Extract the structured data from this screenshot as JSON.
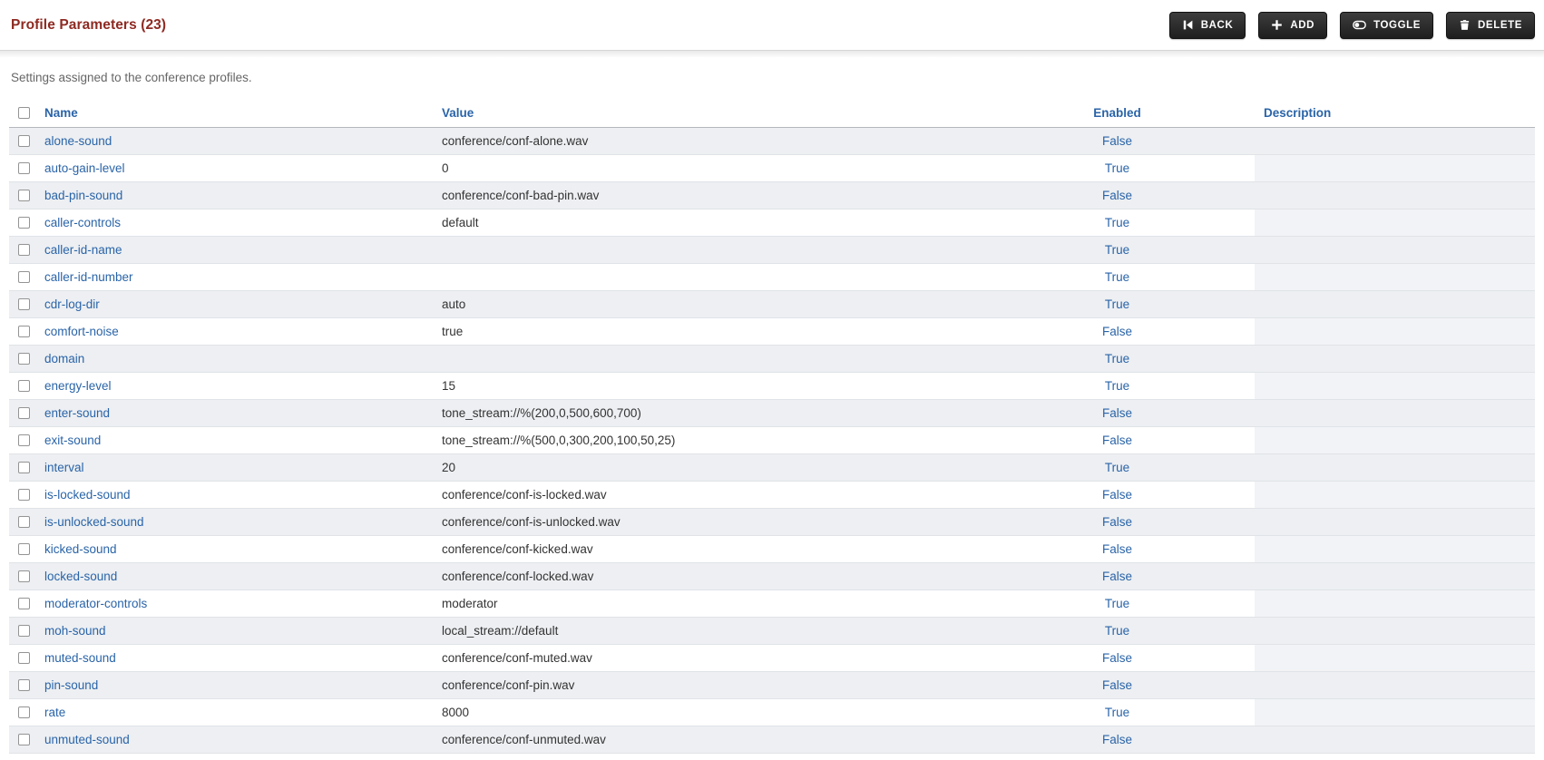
{
  "page": {
    "title": "Profile Parameters (23)",
    "subtitle": "Settings assigned to the conference profiles."
  },
  "toolbar": {
    "back_label": "BACK",
    "add_label": "ADD",
    "toggle_label": "TOGGLE",
    "delete_label": "DELETE",
    "icons": [
      "skip-back-icon",
      "plus-icon",
      "toggle-switch-icon",
      "trash-icon"
    ]
  },
  "colors": {
    "title": "#8e2a22",
    "link_blue": "#2a64a8",
    "button_bg": "#272727",
    "row_stripe": "#edeff2",
    "description_cell": "#f2f3f6"
  },
  "table": {
    "headers": {
      "name": "Name",
      "value": "Value",
      "enabled": "Enabled",
      "description": "Description"
    },
    "rows": [
      {
        "name": "alone-sound",
        "value": "conference/conf-alone.wav",
        "enabled": "False",
        "description": ""
      },
      {
        "name": "auto-gain-level",
        "value": "0",
        "enabled": "True",
        "description": ""
      },
      {
        "name": "bad-pin-sound",
        "value": "conference/conf-bad-pin.wav",
        "enabled": "False",
        "description": ""
      },
      {
        "name": "caller-controls",
        "value": "default",
        "enabled": "True",
        "description": ""
      },
      {
        "name": "caller-id-name",
        "value": "",
        "enabled": "True",
        "description": ""
      },
      {
        "name": "caller-id-number",
        "value": "",
        "enabled": "True",
        "description": ""
      },
      {
        "name": "cdr-log-dir",
        "value": "auto",
        "enabled": "True",
        "description": ""
      },
      {
        "name": "comfort-noise",
        "value": "true",
        "enabled": "False",
        "description": ""
      },
      {
        "name": "domain",
        "value": "",
        "enabled": "True",
        "description": ""
      },
      {
        "name": "energy-level",
        "value": "15",
        "enabled": "True",
        "description": ""
      },
      {
        "name": "enter-sound",
        "value": "tone_stream://%(200,0,500,600,700)",
        "enabled": "False",
        "description": ""
      },
      {
        "name": "exit-sound",
        "value": "tone_stream://%(500,0,300,200,100,50,25)",
        "enabled": "False",
        "description": ""
      },
      {
        "name": "interval",
        "value": "20",
        "enabled": "True",
        "description": ""
      },
      {
        "name": "is-locked-sound",
        "value": "conference/conf-is-locked.wav",
        "enabled": "False",
        "description": ""
      },
      {
        "name": "is-unlocked-sound",
        "value": "conference/conf-is-unlocked.wav",
        "enabled": "False",
        "description": ""
      },
      {
        "name": "kicked-sound",
        "value": "conference/conf-kicked.wav",
        "enabled": "False",
        "description": ""
      },
      {
        "name": "locked-sound",
        "value": "conference/conf-locked.wav",
        "enabled": "False",
        "description": ""
      },
      {
        "name": "moderator-controls",
        "value": "moderator",
        "enabled": "True",
        "description": ""
      },
      {
        "name": "moh-sound",
        "value": "local_stream://default",
        "enabled": "True",
        "description": ""
      },
      {
        "name": "muted-sound",
        "value": "conference/conf-muted.wav",
        "enabled": "False",
        "description": ""
      },
      {
        "name": "pin-sound",
        "value": "conference/conf-pin.wav",
        "enabled": "False",
        "description": ""
      },
      {
        "name": "rate",
        "value": "8000",
        "enabled": "True",
        "description": ""
      },
      {
        "name": "unmuted-sound",
        "value": "conference/conf-unmuted.wav",
        "enabled": "False",
        "description": ""
      }
    ]
  }
}
